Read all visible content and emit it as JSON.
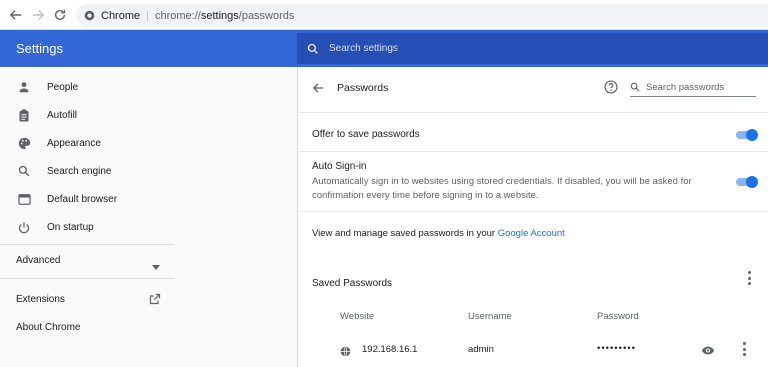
{
  "browser": {
    "site_name": "Chrome",
    "url_host": "chrome://",
    "url_path_bold": "settings",
    "url_path": "/passwords"
  },
  "header": {
    "title": "Settings",
    "search_placeholder": "Search settings"
  },
  "sidebar": {
    "items": [
      {
        "label": "People",
        "icon": "person-icon"
      },
      {
        "label": "Autofill",
        "icon": "clipboard-icon"
      },
      {
        "label": "Appearance",
        "icon": "palette-icon"
      },
      {
        "label": "Search engine",
        "icon": "search-icon"
      },
      {
        "label": "Default browser",
        "icon": "browser-icon"
      },
      {
        "label": "On startup",
        "icon": "power-icon"
      }
    ],
    "advanced_label": "Advanced",
    "extensions_label": "Extensions",
    "about_label": "About Chrome"
  },
  "passwords": {
    "title": "Passwords",
    "search_placeholder": "Search passwords",
    "offer_label": "Offer to save passwords",
    "offer_enabled": true,
    "autosignin_label": "Auto Sign-in",
    "autosignin_desc_1": "Automatically sign in to websites using stored credentials. If disabled, you will be asked for",
    "autosignin_desc_2": "confirmation every time before signing in to a website.",
    "autosignin_enabled": true,
    "manage_text": "View and manage saved passwords in your ",
    "manage_link": "Google Account",
    "saved_title": "Saved Passwords",
    "columns": {
      "website": "Website",
      "username": "Username",
      "password": "Password"
    },
    "entries": [
      {
        "website": "192.168.16.1",
        "username": "admin",
        "password": "•••••••••"
      }
    ]
  },
  "colors": {
    "header_bg": "#3367d6",
    "accent": "#1a73e8",
    "sidebar_bg": "#f8f9fa"
  }
}
